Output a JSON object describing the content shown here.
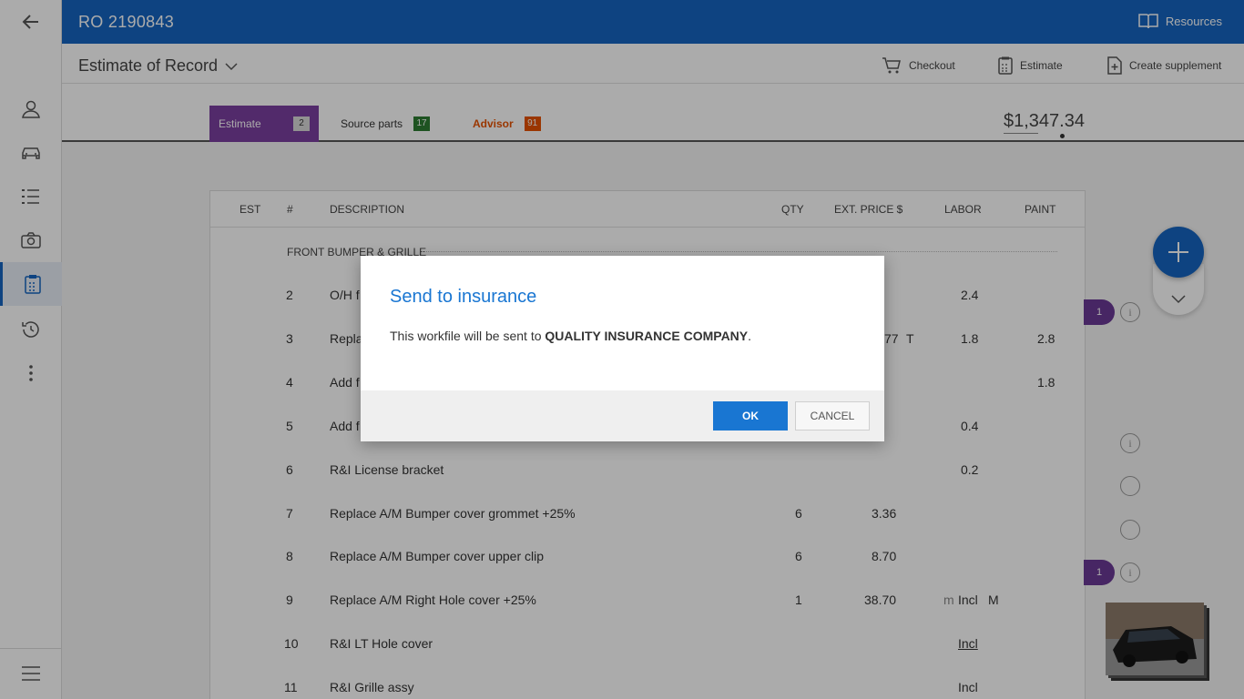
{
  "topbar": {
    "ro_number": "RO 2190843",
    "resources_label": "Resources"
  },
  "subheader": {
    "title": "Estimate of Record",
    "actions": {
      "checkout": "Checkout",
      "estimate": "Estimate",
      "create_supplement": "Create supplement"
    }
  },
  "tabs": [
    {
      "label": "Estimate",
      "count": "2",
      "badge_color": "#d9d9d9",
      "active": true
    },
    {
      "label": "Source parts",
      "count": "17",
      "badge_color": "#2e7d32",
      "active": false
    },
    {
      "label": "Advisor",
      "count": "91",
      "badge_color": "#e65100",
      "active": false
    }
  ],
  "total": "$1,347.34",
  "table": {
    "headers": {
      "est": "EST",
      "num": "#",
      "description": "DESCRIPTION",
      "qty": "QTY",
      "ext_price": "EXT. PRICE $",
      "labor": "LABOR",
      "paint": "PAINT"
    },
    "section": "FRONT BUMPER & GRILLE",
    "rows": [
      {
        "num": "2",
        "desc": "O/H f",
        "qty": "",
        "price": "",
        "flag": "",
        "labor": "2.4",
        "paint": ""
      },
      {
        "num": "3",
        "desc": "Repla",
        "qty": "",
        "price": "77",
        "flag": "T",
        "labor": "1.8",
        "paint": "2.8"
      },
      {
        "num": "4",
        "desc": "Add f",
        "qty": "",
        "price": "",
        "flag": "",
        "labor": "",
        "paint": "1.8"
      },
      {
        "num": "5",
        "desc": "Add f",
        "qty": "",
        "price": "",
        "flag": "",
        "labor": "0.4",
        "paint": ""
      },
      {
        "num": "6",
        "desc": "R&I License bracket",
        "qty": "",
        "price": "",
        "flag": "",
        "labor": "0.2",
        "paint": ""
      },
      {
        "num": "7",
        "desc": "Replace A/M Bumper cover grommet +25%",
        "qty": "6",
        "price": "3.36",
        "flag": "",
        "labor": "",
        "paint": ""
      },
      {
        "num": "8",
        "desc": "Replace A/M Bumper cover upper clip",
        "qty": "6",
        "price": "8.70",
        "flag": "",
        "labor": "",
        "paint": ""
      },
      {
        "num": "9",
        "desc": "Replace A/M Right Hole cover +25%",
        "qty": "1",
        "price": "38.70",
        "flag": "m",
        "labor": "Incl",
        "paint": "M"
      },
      {
        "num": "10",
        "desc": "R&I LT Hole cover",
        "qty": "",
        "price": "",
        "flag": "",
        "labor": "Incl",
        "paint": ""
      },
      {
        "num": "11",
        "desc": "R&I Grille assy",
        "qty": "",
        "price": "",
        "flag": "",
        "labor": "Incl",
        "paint": ""
      }
    ]
  },
  "side": {
    "pill_count_1": "1",
    "pill_count_2": "1",
    "info_glyph": "i"
  },
  "dialog": {
    "title": "Send to insurance",
    "message_prefix": "This workfile will be sent to ",
    "company": "QUALITY INSURANCE COMPANY",
    "message_suffix": ".",
    "ok_label": "OK",
    "cancel_label": "CANCEL"
  },
  "icons": [
    "back-arrow-icon",
    "user-icon",
    "car-icon",
    "list-icon",
    "camera-icon",
    "clipboard-icon",
    "history-icon",
    "more-vertical-icon",
    "menu-icon",
    "book-icon",
    "cart-icon",
    "calculator-icon",
    "add-document-icon",
    "chevron-down-icon",
    "plus-icon",
    "info-icon"
  ],
  "colors": {
    "primary": "#1565c0",
    "tab_active": "#7b3fa0",
    "dialog_title": "#1976d2"
  }
}
